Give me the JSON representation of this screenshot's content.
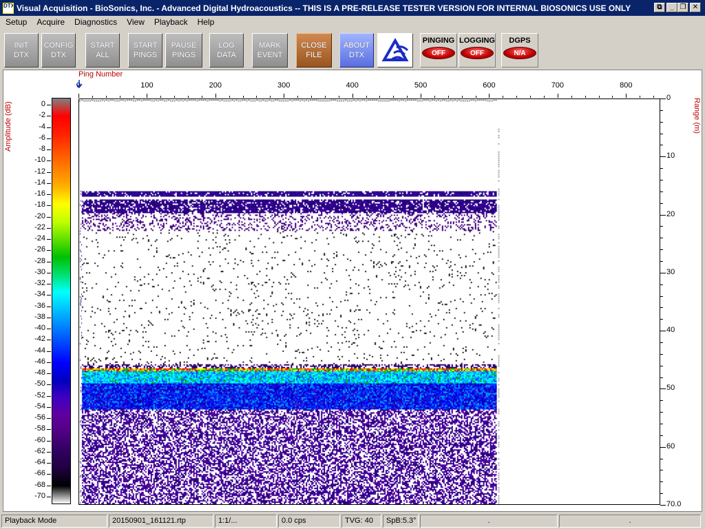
{
  "window": {
    "title": "Visual Acquisition  -  BioSonics, Inc.  -  Advanced Digital Hydroacoustics  -- THIS IS A PRE-RELEASE TESTER VERSION FOR INTERNAL BIOSONICS USE ONLY",
    "icon_text": "DTX",
    "minimize": "_",
    "restore": "❐",
    "close": "✕",
    "help": "⧉"
  },
  "menu": [
    "Setup",
    "Acquire",
    "Diagnostics",
    "View",
    "Playback",
    "Help"
  ],
  "toolbar": {
    "init": "INIT\nDTX",
    "config": "CONFIG\nDTX",
    "start_all": "START\nALL",
    "start_pings": "START\nPINGS",
    "pause_pings": "PAUSE\nPINGS",
    "log_data": "LOG\nDATA",
    "mark_event": "MARK\nEVENT",
    "close_file": "CLOSE\nFILE",
    "about": "ABOUT\nDTX",
    "pinging_label": "PINGING",
    "pinging_state": "OFF",
    "logging_label": "LOGGING",
    "logging_state": "OFF",
    "dgps_label": "DGPS",
    "dgps_state": "N/A"
  },
  "colors": {
    "ramp": [
      "#808080",
      "#ff0000",
      "#ff2000",
      "#ff5000",
      "#ff8000",
      "#ffb000",
      "#ffff00",
      "#c0ff00",
      "#60e000",
      "#00c000",
      "#00e070",
      "#00ffff",
      "#00c0ff",
      "#0080ff",
      "#0040ff",
      "#0000ff",
      "#0000c0",
      "#4000c0",
      "#6000a0",
      "#500080",
      "#300060",
      "#200040",
      "#000000",
      "#ffffff"
    ]
  },
  "echogram": {
    "ping_axis_label": "Ping Number",
    "ping_ticks": [
      "0",
      "100",
      "200",
      "300",
      "400",
      "500",
      "600",
      "700",
      "800"
    ],
    "ping_max": 850,
    "range_axis_label": "Range (m)",
    "range_ticks": [
      "0",
      "10",
      "20",
      "30",
      "40",
      "50",
      "60",
      "70.0"
    ],
    "range_max": 70,
    "amplitude_label": "Amplitude (dB)",
    "amplitude_ticks": [
      "0",
      "-2",
      "-4",
      "-6",
      "-8",
      "-10",
      "-12",
      "-14",
      "-16",
      "-18",
      "-20",
      "-22",
      "-24",
      "-26",
      "-28",
      "-30",
      "-32",
      "-34",
      "-36",
      "-38",
      "-40",
      "-42",
      "-44",
      "-46",
      "-48",
      "-50",
      "-52",
      "-54",
      "-56",
      "-58",
      "-60",
      "-62",
      "-64",
      "-66",
      "-68",
      "-70"
    ],
    "amplitude_min": -70,
    "pings_recorded": 610,
    "surface_layer_range": [
      15.8,
      19.0
    ],
    "bottom_range": 46.5
  },
  "status": {
    "mode": "Playback Mode",
    "file": "20150901_161121.rtp",
    "ratio": "1:1/...",
    "rate": "0.0 cps",
    "tvg": "TVG: 40",
    "spb": "SpB:5.3°",
    "extra1": ".",
    "extra2": "."
  }
}
